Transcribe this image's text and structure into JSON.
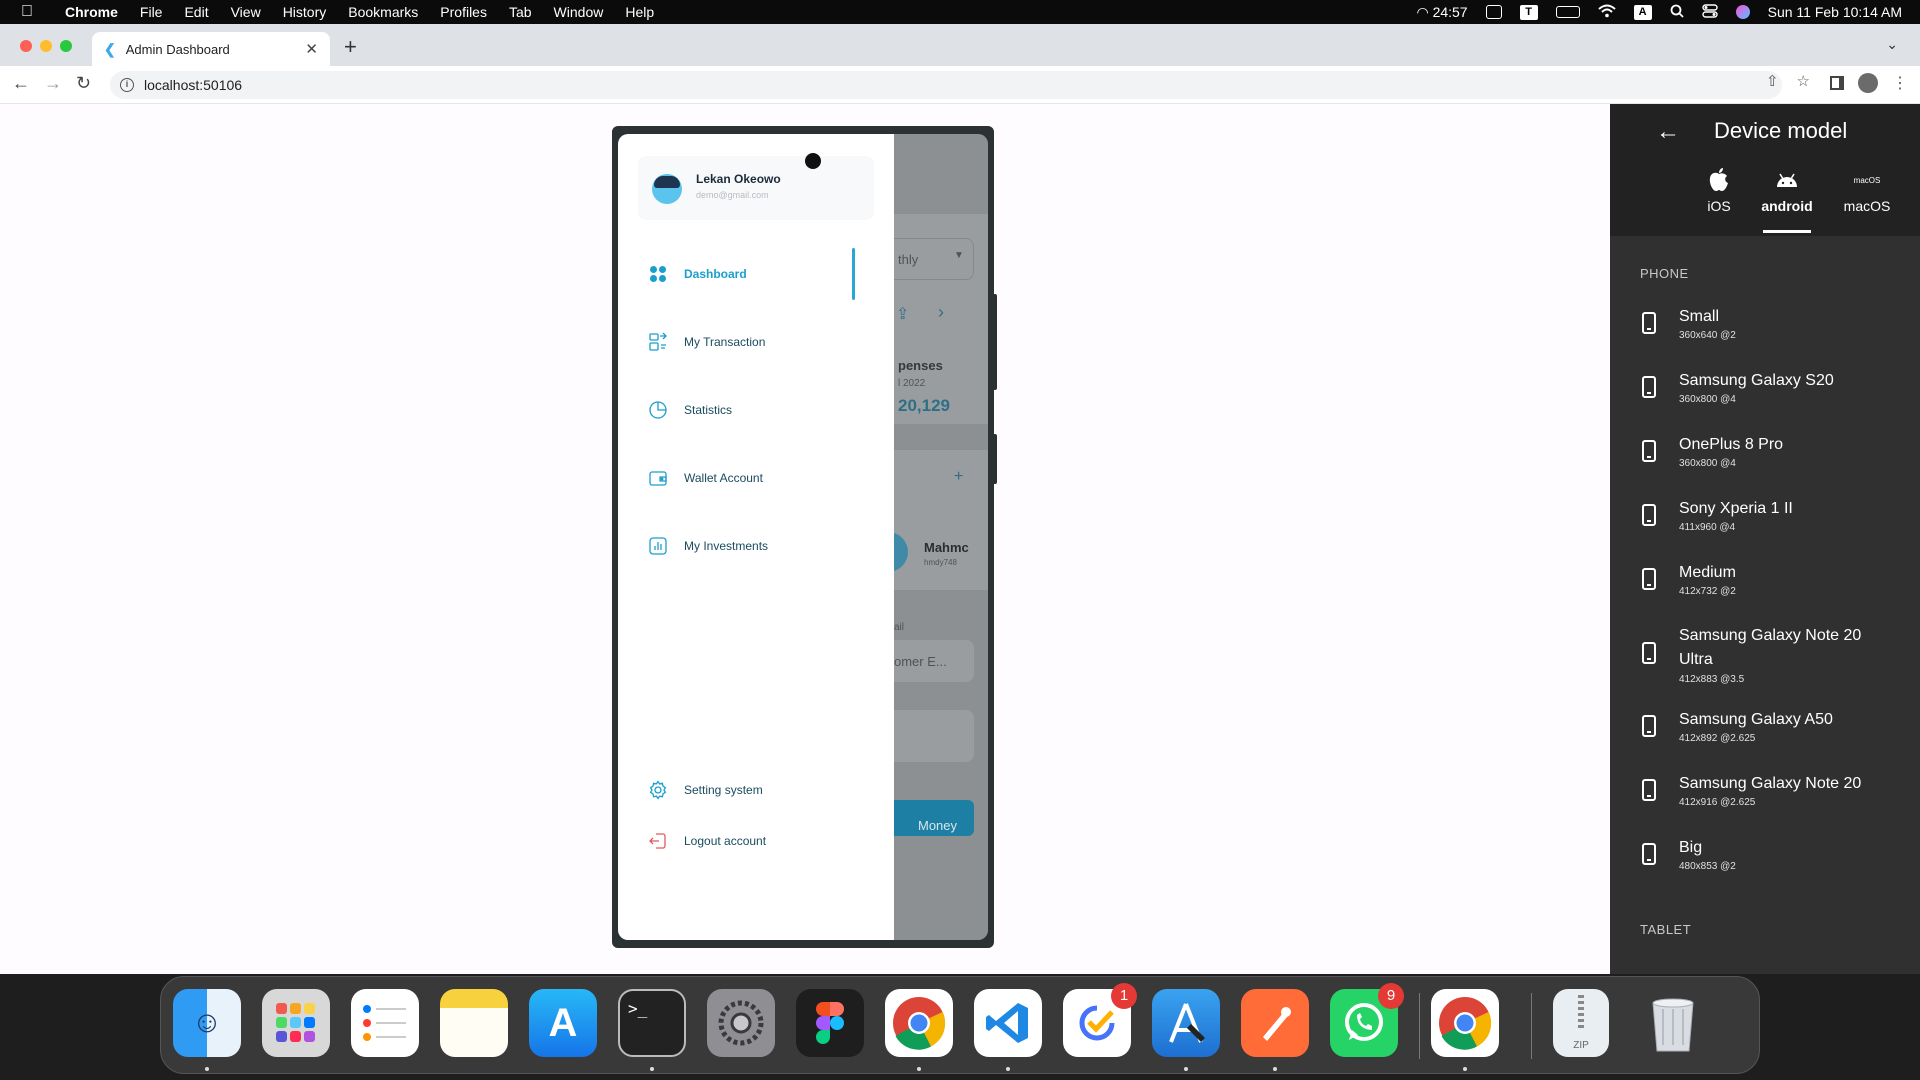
{
  "menubar": {
    "app": "Chrome",
    "items": [
      "File",
      "Edit",
      "View",
      "History",
      "Bookmarks",
      "Profiles",
      "Tab",
      "Window",
      "Help"
    ],
    "timer": "24:57",
    "input_source": "A",
    "datetime": "Sun 11 Feb  10:14 AM"
  },
  "browser": {
    "tab_title": "Admin Dashboard",
    "url": "localhost:50106"
  },
  "app": {
    "profile": {
      "name": "Lekan Okeowo",
      "email": "demo@gmail.com"
    },
    "nav": [
      {
        "label": "Dashboard",
        "icon": "dashboard-grid-icon",
        "active": true
      },
      {
        "label": "My Transaction",
        "icon": "transaction-icon"
      },
      {
        "label": "Statistics",
        "icon": "pie-chart-icon"
      },
      {
        "label": "Wallet Account",
        "icon": "wallet-icon"
      },
      {
        "label": "My Investments",
        "icon": "bar-chart-icon"
      }
    ],
    "bottom_nav": [
      {
        "label": "Setting system",
        "icon": "gear-icon"
      },
      {
        "label": "Logout account",
        "icon": "logout-icon"
      }
    ],
    "background": {
      "period": "thly",
      "expenses_label": "penses",
      "expenses_date": "l 2022",
      "expenses_value": "20,129",
      "contact_name": "Mahmc",
      "contact_handle": "hmdy748",
      "email_label": "ail",
      "customer_field": "omer E...",
      "button_label": "Money"
    }
  },
  "device_panel": {
    "title": "Device model",
    "os_tabs": [
      "iOS",
      "android",
      "macOS"
    ],
    "active_os": "android",
    "macos_icon_text": "macOS",
    "phone_label": "PHONE",
    "tablet_label": "TABLET",
    "devices": [
      {
        "name": "Small",
        "spec": "360x640 @2"
      },
      {
        "name": "Samsung Galaxy S20",
        "spec": "360x800 @4"
      },
      {
        "name": "OnePlus 8 Pro",
        "spec": "360x800 @4"
      },
      {
        "name": "Sony Xperia 1 II",
        "spec": "411x960 @4"
      },
      {
        "name": "Medium",
        "spec": "412x732 @2"
      },
      {
        "name": "Samsung Galaxy Note 20 Ultra",
        "spec": "412x883 @3.5"
      },
      {
        "name": "Samsung Galaxy A50",
        "spec": "412x892 @2.625"
      },
      {
        "name": "Samsung Galaxy Note 20",
        "spec": "412x916 @2.625"
      },
      {
        "name": "Big",
        "spec": "480x853 @2"
      }
    ]
  },
  "dock": {
    "apps": [
      {
        "name": "Finder"
      },
      {
        "name": "Launchpad"
      },
      {
        "name": "Reminders"
      },
      {
        "name": "Notes"
      },
      {
        "name": "App Store"
      },
      {
        "name": "Terminal"
      },
      {
        "name": "System Settings"
      },
      {
        "name": "Figma"
      },
      {
        "name": "Chrome"
      },
      {
        "name": "VS Code"
      },
      {
        "name": "TickTick",
        "badge": "1"
      },
      {
        "name": "Xcode Simulator"
      },
      {
        "name": "Postman"
      },
      {
        "name": "WhatsApp",
        "badge": "9"
      },
      {
        "name": "Chrome (minimized)"
      },
      {
        "name": "Archive",
        "label": "ZIP"
      },
      {
        "name": "Trash"
      }
    ]
  },
  "colors": {
    "accent": "#1a9fcc",
    "nav_text": "#1a4b5f",
    "logout": "#e05a5a",
    "panel_bg": "#303030"
  }
}
